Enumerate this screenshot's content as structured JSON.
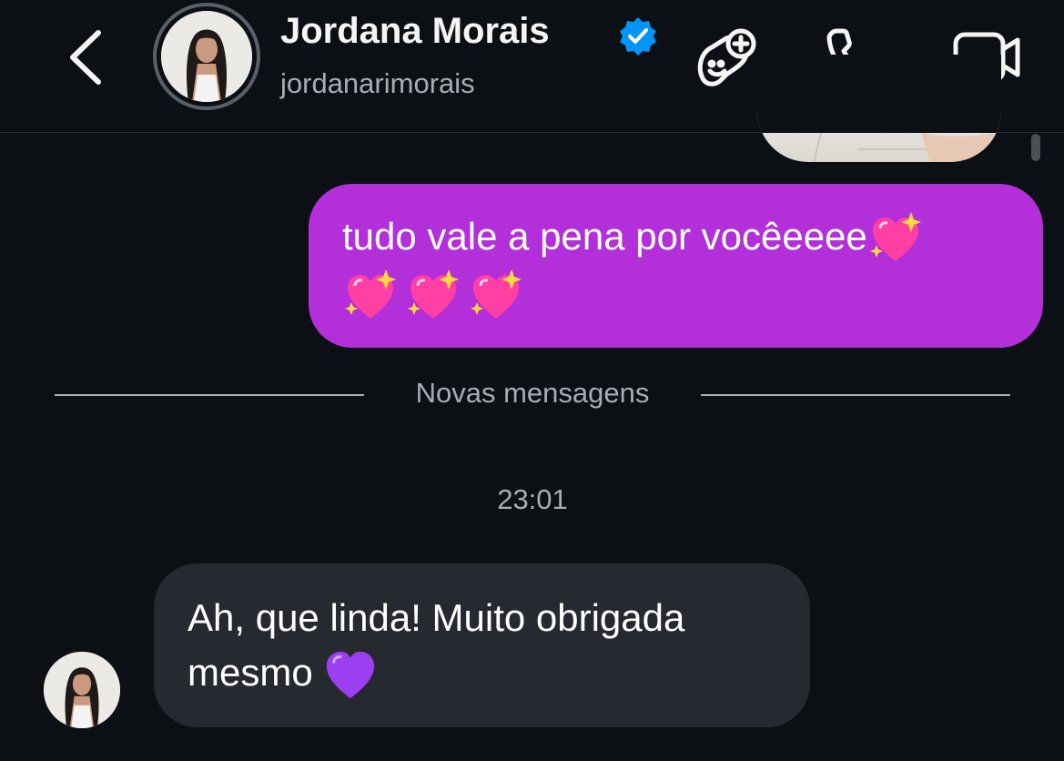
{
  "header": {
    "name": "Jordana Morais",
    "handle": "jordanarimorais",
    "verified": true,
    "icons": {
      "back": "chevron-left-icon",
      "game": "game-controller-add-icon",
      "call": "phone-icon",
      "video": "video-camera-icon"
    }
  },
  "messages": {
    "sent": {
      "line1": "tudo vale a pena por vocêeeee",
      "emoji": "sparkling-heart"
    },
    "divider": "Novas mensagens",
    "timestamp": "23:01",
    "received": {
      "line1": "Ah, que linda! Muito obrigada",
      "line2": "mesmo",
      "emoji": "purple-heart"
    }
  },
  "colors": {
    "background": "#0c1014",
    "sent_bubble": "#b22fd9",
    "received_bubble": "#262a30",
    "verified_badge": "#0095f6",
    "muted_text": "#a8adb5"
  }
}
